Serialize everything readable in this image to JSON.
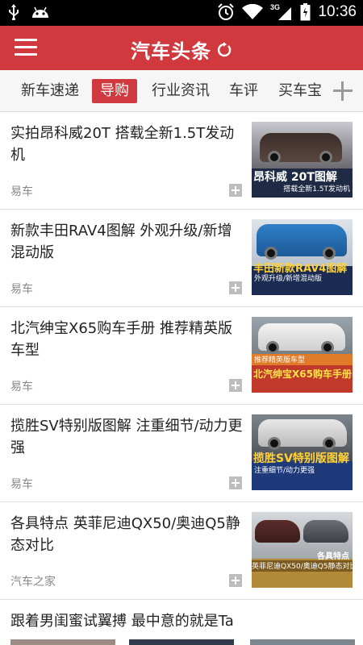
{
  "status_bar": {
    "time": "10:36",
    "network": "3G",
    "icons": [
      "usb-icon",
      "android-icon",
      "alarm-icon",
      "wifi-icon",
      "signal-icon",
      "battery-icon"
    ]
  },
  "header": {
    "title": "汽车头条",
    "brand_color": "#d03a3e"
  },
  "tabs": [
    {
      "label": "新车速递",
      "active": false
    },
    {
      "label": "导购",
      "active": true
    },
    {
      "label": "行业资讯",
      "active": false
    },
    {
      "label": "车评",
      "active": false
    },
    {
      "label": "买车宝",
      "active": false
    }
  ],
  "news": [
    {
      "title": "实拍昂科威20T 搭载全新1.5T发动机",
      "source": "易车",
      "thumb_caption": "昂科威 20T图解",
      "thumb_sub": "搭载全新1.5T发动机"
    },
    {
      "title": "新款丰田RAV4图解 外观升级/新增混动版",
      "source": "易车",
      "thumb_caption": "丰田新款RAV4图解",
      "thumb_sub": "外观升级/新增混动版"
    },
    {
      "title": "北汽绅宝X65购车手册 推荐精英版车型",
      "source": "易车",
      "thumb_caption": "北汽绅宝X65购车手册",
      "thumb_sub": "推荐精英版车型"
    },
    {
      "title": "揽胜SV特别版图解 注重细节/动力更强",
      "source": "易车",
      "thumb_caption": "揽胜SV特别版图解",
      "thumb_sub": "注重细节/动力更强"
    },
    {
      "title": "各具特点 英菲尼迪QX50/奥迪Q5静态对比",
      "source": "汽车之家",
      "thumb_caption": "各具特点",
      "thumb_sub": "英菲尼迪QX50/奥迪Q5静态对比"
    },
    {
      "title": "跟着男闺蜜试翼搏 最中意的就是Ta"
    }
  ]
}
